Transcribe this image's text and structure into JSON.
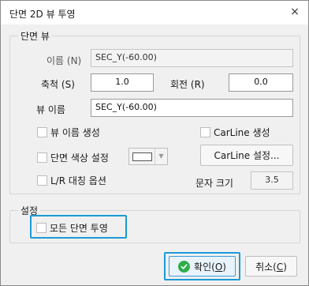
{
  "window": {
    "title": "단면 2D 뷰 투영",
    "close_glyph": "×"
  },
  "section_view": {
    "group_title": "단면 뷰",
    "name_label": "이름 (N)",
    "name_value": "SEC_Y(-60.00)",
    "scale_label": "축척 (S)",
    "scale_value": "1.0",
    "rotation_label": "회전 (R)",
    "rotation_value": "0.0",
    "view_name_label": "뷰 이름",
    "view_name_value": "SEC_Y(-60.00)",
    "create_view_name": "뷰 이름 생성",
    "carline_create": "CarLine 생성",
    "section_color": "단면 색상 설정",
    "section_color_value": "#ffffff",
    "carline_settings": "CarLine 설정...",
    "lr_mirror": "L/R 대칭 옵션",
    "text_size_label": "문자 크기",
    "text_size_value": "3.5"
  },
  "settings": {
    "group_title": "설정",
    "all_section_projection": "모든 단면 투영"
  },
  "buttons": {
    "ok_text": "확인(",
    "ok_key": "O",
    "ok_end": ")",
    "cancel_text": "취소(",
    "cancel_key": "C",
    "cancel_end": ")"
  },
  "colors": {
    "highlight": "#1b9ad6",
    "ok_icon": "#2fae4a"
  }
}
